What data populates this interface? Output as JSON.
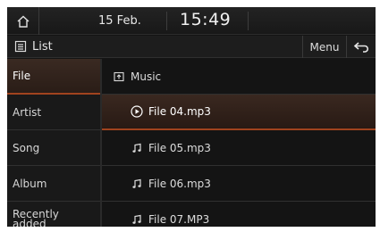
{
  "status": {
    "date": "15 Feb.",
    "time": "15:49"
  },
  "titlebar": {
    "title": "List",
    "menu_label": "Menu"
  },
  "categories": [
    {
      "label": "File",
      "active": true
    },
    {
      "label": "Artist",
      "active": false
    },
    {
      "label": "Song",
      "active": false
    },
    {
      "label": "Album",
      "active": false
    },
    {
      "label_line1": "Recently",
      "label_line2": "added",
      "active": false
    }
  ],
  "files": {
    "folder": "Music",
    "items": [
      {
        "name": "File 04.mp3",
        "playing": true,
        "icon": "play-circle-icon"
      },
      {
        "name": "File 05.mp3",
        "playing": false,
        "icon": "music-note-icon"
      },
      {
        "name": "File 06.mp3",
        "playing": false,
        "icon": "music-note-icon"
      },
      {
        "name": "File 07.MP3",
        "playing": false,
        "icon": "music-note-icon"
      }
    ]
  },
  "colors": {
    "accent": "#a0431e",
    "background": "#141414"
  }
}
